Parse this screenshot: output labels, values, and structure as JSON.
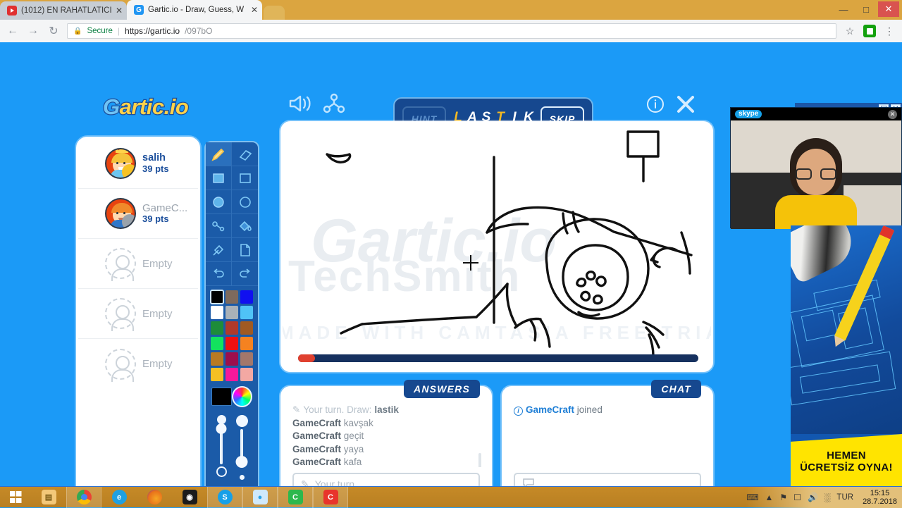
{
  "browser": {
    "tabs": [
      {
        "title": "(1012) EN RAHATLATICI",
        "favicon": "youtube-icon",
        "active": false
      },
      {
        "title": "Gartic.io - Draw, Guess, W",
        "favicon": "gartic-icon",
        "active": true
      }
    ],
    "tab_close_label": "✕",
    "window_controls": {
      "minimize": "—",
      "maximize": "□",
      "close": "✕"
    },
    "nav": {
      "back": "←",
      "forward": "→",
      "reload": "↻"
    },
    "omnibox": {
      "lock_icon": "lock-icon",
      "security_label": "Secure",
      "separator": "|",
      "url_bold": "https://gartic.io",
      "url_gray": "/097bO"
    },
    "star_icon": "☆",
    "menu_icon": "⋮"
  },
  "game": {
    "logo": {
      "part1": "G",
      "part2": "artic.io"
    },
    "header_icons": {
      "speaker": "speaker-icon",
      "share": "share-icon",
      "info": "ⓘ",
      "close": "✕"
    },
    "wordbar": {
      "hint_label": "HINT",
      "skip_label": "SKIP",
      "word_letters": [
        {
          "ch": "L",
          "revealed": true
        },
        {
          "ch": "A",
          "revealed": false
        },
        {
          "ch": "S",
          "revealed": false
        },
        {
          "ch": "T",
          "revealed": true
        },
        {
          "ch": "I",
          "revealed": false
        },
        {
          "ch": "K",
          "revealed": false
        }
      ]
    },
    "players": [
      {
        "name": "salih",
        "points": "39 pts",
        "empty": false,
        "crown": true,
        "status_color": "#f7c325",
        "avatar_kind": "salih"
      },
      {
        "name": "GameC...",
        "points": "39 pts",
        "empty": false,
        "crown": false,
        "status_color": "#9aa3ab",
        "avatar_kind": "gamecraft"
      },
      {
        "name": "Empty",
        "points": "",
        "empty": true
      },
      {
        "name": "Empty",
        "points": "",
        "empty": true
      },
      {
        "name": "Empty",
        "points": "",
        "empty": true
      }
    ],
    "tools": [
      {
        "icon": "pencil-icon",
        "glyph": "✎",
        "selected": true
      },
      {
        "icon": "eraser-icon",
        "glyph": "▱",
        "selected": false
      },
      {
        "icon": "filled-rectangle-icon",
        "glyph": "■",
        "selected": false
      },
      {
        "icon": "rectangle-outline-icon",
        "glyph": "□",
        "selected": false
      },
      {
        "icon": "filled-ellipse-icon",
        "glyph": "●",
        "selected": false
      },
      {
        "icon": "ellipse-outline-icon",
        "glyph": "○",
        "selected": false
      },
      {
        "icon": "line-icon",
        "glyph": "⚯",
        "selected": false
      },
      {
        "icon": "paint-bucket-icon",
        "glyph": "⚈",
        "selected": false
      },
      {
        "icon": "eyedropper-icon",
        "glyph": "✒",
        "selected": false
      },
      {
        "icon": "new-page-icon",
        "glyph": "὜b",
        "selected": false
      },
      {
        "icon": "undo-icon",
        "glyph": "↶",
        "selected": false
      },
      {
        "icon": "redo-icon",
        "glyph": "↷",
        "selected": false
      }
    ],
    "palette_colors": [
      "#000000",
      "#7e6a5c",
      "#1010f0",
      "#ffffff",
      "#a9b1b8",
      "#4fc3f7",
      "#1d8c3a",
      "#b0392b",
      "#a05a22",
      "#12e35e",
      "#f01010",
      "#f58220",
      "#b97a22",
      "#9c0f4d",
      "#a3776b",
      "#f5c023",
      "#f7199b",
      "#f3a8a3"
    ],
    "selected_color_index": 0,
    "current_color": "#000000",
    "color_wheel_icon": "color-wheel-icon",
    "canvas": {
      "watermark_gartic": "Gartic.io",
      "watermark_tech": "TechSmith",
      "watermark_trial": "MADE WITH CAMTASIA FREE TRIAL",
      "progress_percent": 4
    },
    "answers": {
      "tab_label": "ANSWERS",
      "turn_prefix": "Your turn. Draw:",
      "turn_word": "lastik",
      "messages": [
        {
          "nick": "GameCraft",
          "text": "kavşak"
        },
        {
          "nick": "GameCraft",
          "text": "geçit"
        },
        {
          "nick": "GameCraft",
          "text": "yaya"
        },
        {
          "nick": "GameCraft",
          "text": "kafa"
        }
      ],
      "input_placeholder": "Your turn",
      "input_icon": "pencil-icon"
    },
    "chat": {
      "tab_label": "CHAT",
      "messages": [
        {
          "icon": "info-icon",
          "nick": "GameCraft",
          "text": "joined"
        }
      ],
      "input_placeholder": "",
      "input_icon": "speech-bubble-icon"
    }
  },
  "skype": {
    "logo_label": "skype",
    "close_label": "✕"
  },
  "ad": {
    "cta_line1": "HEMEN",
    "cta_line2": "ÜCRETSİZ OYNA!",
    "window_buttons": [
      "☐",
      "✕"
    ]
  },
  "taskbar": {
    "start_icon": "windows-start-icon",
    "items": [
      {
        "name": "file-explorer",
        "label": "▤",
        "color": "#f0c068",
        "running": false
      },
      {
        "name": "chrome",
        "label": "●",
        "color": "#4285f4",
        "running": true
      },
      {
        "name": "internet-explorer",
        "label": "e",
        "color": "#1fa0e0",
        "running": false
      },
      {
        "name": "firefox",
        "label": "◐",
        "color": "#e8701a",
        "running": false
      },
      {
        "name": "camera-app",
        "label": "◉",
        "color": "#1b1b1b",
        "running": false
      },
      {
        "name": "skype",
        "label": "S",
        "color": "#16a0e8",
        "running": true
      },
      {
        "name": "hotspot-shield",
        "label": "◑",
        "color": "#3ab0f0",
        "running": true
      },
      {
        "name": "camtasia-recorder",
        "label": "C",
        "color": "#2db84d",
        "running": true
      },
      {
        "name": "camtasia-studio",
        "label": "C",
        "color": "#e8342c",
        "running": true
      }
    ],
    "tray": {
      "keyboard_icon": "keyboard-icon",
      "show_hidden_icon": "▲",
      "network_icon": "network-icon",
      "action_icon": "action-center-icon",
      "volume_icon": "◂))",
      "signal_icon": "signal-icon",
      "language": "TUR",
      "time": "15:15",
      "date": "28.7.2018"
    }
  }
}
